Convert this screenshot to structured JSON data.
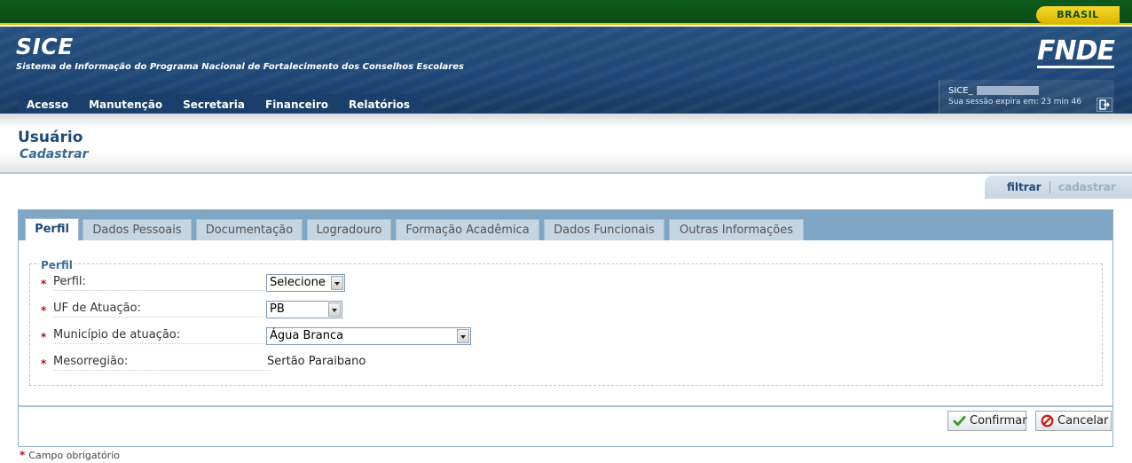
{
  "govbar": {
    "brasil_label": "BRASIL"
  },
  "header": {
    "app_title": "SICE",
    "app_subtitle": "Sistema de Informação do Programa Nacional de Fortalecimento dos Conselhos Escolares",
    "logo": "FNDE"
  },
  "menu": {
    "items": [
      {
        "label": "Acesso"
      },
      {
        "label": "Manutenção"
      },
      {
        "label": "Secretaria"
      },
      {
        "label": "Financeiro"
      },
      {
        "label": "Relatórios"
      }
    ]
  },
  "session": {
    "user_prefix": "SICE_",
    "expire_text": "Sua sessão expira em: 23 min 46",
    "logout_icon": "logout-icon"
  },
  "page": {
    "title": "Usuário",
    "subtitle": "Cadastrar"
  },
  "actions": {
    "filter_label": "filtrar",
    "create_label": "cadastrar"
  },
  "tabs": [
    {
      "label": "Perfil",
      "active": true
    },
    {
      "label": "Dados Pessoais"
    },
    {
      "label": "Documentação"
    },
    {
      "label": "Logradouro"
    },
    {
      "label": "Formação Acadêmica"
    },
    {
      "label": "Dados Funcionais"
    },
    {
      "label": "Outras Informações"
    }
  ],
  "form": {
    "legend": "Perfil",
    "required_mark": "*",
    "fields": {
      "perfil": {
        "label": "Perfil:",
        "value": "Selecione"
      },
      "uf": {
        "label": "UF de Atuação:",
        "value": "PB"
      },
      "municipio": {
        "label": "Município de atuação:",
        "value": "Água Branca"
      },
      "mesorregiao": {
        "label": "Mesorregião:",
        "value": "Sertão Paraibano"
      }
    }
  },
  "buttons": {
    "confirm": "Confirmar",
    "cancel": "Cancelar"
  },
  "footer": {
    "required_note": "Campo obrigatório"
  },
  "colors": {
    "header_blue": "#1e4676",
    "gov_green": "#0b4d16",
    "gov_yellow": "#e2c400",
    "title_blue": "#1d4b74",
    "tab_bar": "#7fa6c4",
    "required_red": "#b01010"
  }
}
